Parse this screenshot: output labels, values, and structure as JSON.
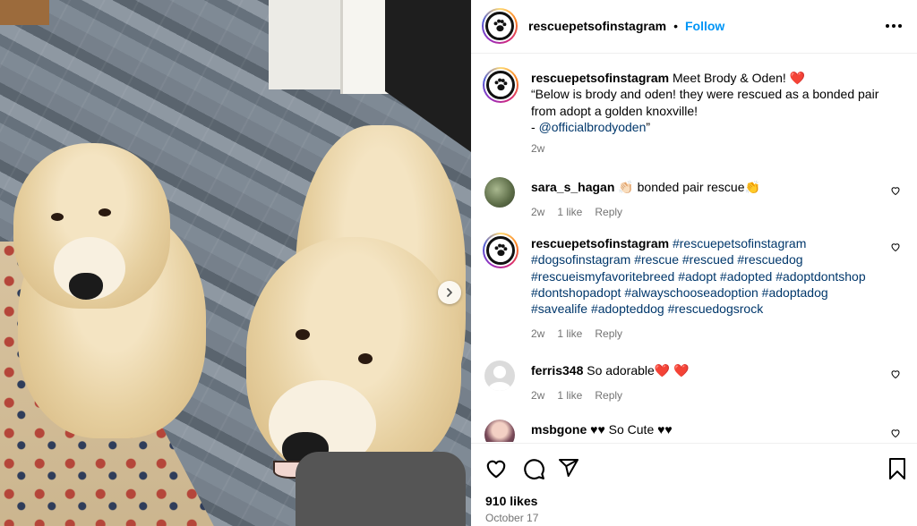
{
  "header": {
    "username": "rescuepetsofinstagram",
    "separator": "•",
    "follow_label": "Follow"
  },
  "caption": {
    "username": "rescuepetsofinstagram",
    "title": "Meet Brody & Oden!",
    "title_emoji": "❤️",
    "quote_line1": "“Below is brody and oden! they were rescued as a bonded pair",
    "quote_line2": "from adopt a golden knoxville!",
    "credit_prefix": "- ",
    "credit_handle": "@officialbrodyoden",
    "credit_suffix": "”",
    "time": "2w"
  },
  "comments": [
    {
      "username": "sara_s_hagan",
      "text_before": "👏🏻",
      "text": "bonded pair rescue",
      "text_after": "👏",
      "time": "2w",
      "likes": "1 like",
      "reply": "Reply"
    },
    {
      "username": "rescuepetsofinstagram",
      "tags": [
        "#rescuepetsofinstagram",
        "#dogsofinstagram",
        "#rescue",
        "#rescued",
        "#rescuedog",
        "#rescueismyfavoritebreed",
        "#adopt",
        "#adopted",
        "#adoptdontshop",
        "#dontshopadopt",
        "#alwayschooseadoption",
        "#adoptadog",
        "#savealife",
        "#adopteddog",
        "#rescuedogsrock"
      ],
      "time": "2w",
      "likes": "1 like",
      "reply": "Reply"
    },
    {
      "username": "ferris348",
      "text": "So adorable",
      "text_after": "❤️ ❤️",
      "time": "2w",
      "likes": "1 like",
      "reply": "Reply"
    },
    {
      "username": "msbgone",
      "text": "♥♥ So Cute ♥♥"
    }
  ],
  "footer": {
    "likes": "910 likes",
    "date": "October 17"
  },
  "icons": {
    "like": "heart-icon",
    "comment": "comment-icon",
    "share": "share-icon",
    "save": "bookmark-icon",
    "more": "more-icon",
    "next": "chevron-right-icon"
  },
  "colors": {
    "follow": "#0095f6",
    "hashtag": "#00376b",
    "heart": "#ed4956",
    "muted": "#737373"
  }
}
